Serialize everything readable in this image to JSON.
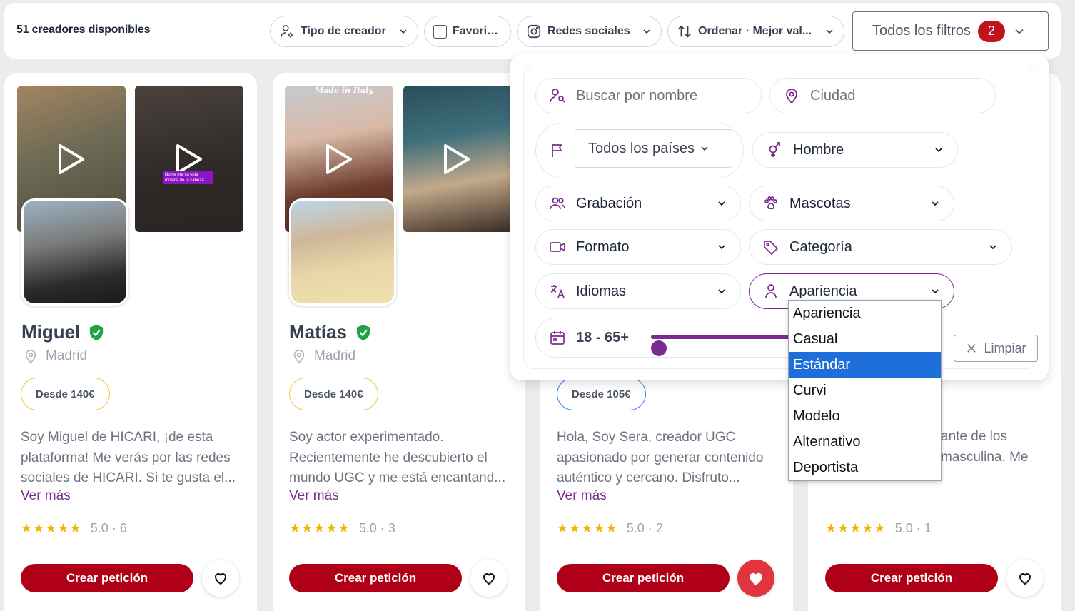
{
  "header": {
    "count_label": "51 creadores disponibles",
    "filters": [
      {
        "label": "Tipo de creador",
        "icon": "user-gear-icon"
      },
      {
        "label": "Favoritos",
        "icon": "checkbox-icon"
      },
      {
        "label": "Redes sociales",
        "icon": "instagram-icon"
      },
      {
        "label": "Ordenar · Mejor val...",
        "icon": "sort-icon"
      }
    ],
    "all_filters": {
      "label": "Todos los filtros",
      "badge": "2"
    }
  },
  "cards": [
    {
      "name": "Miguel",
      "verified": true,
      "city": "Madrid",
      "price": "Desde 140€",
      "description": "Soy Miguel de HICARI, ¡de esta plataforma! Me verás por las redes sociales de HICARI. Si te gusta el...",
      "more": "Ver más",
      "stars": "★★★★★",
      "rating": "5.0 · 6",
      "cta": "Crear petición",
      "favorite": false
    },
    {
      "name": "Matías",
      "verified": true,
      "city": "Madrid",
      "price": "Desde 140€",
      "description": "Soy actor experimentado. Recientemente he descubierto el mundo UGC y me está encantand...",
      "more": "Ver más",
      "stars": "★★★★★",
      "rating": "5.0 · 3",
      "cta": "Crear petición",
      "favorite": false
    },
    {
      "name": "",
      "verified": false,
      "city": "",
      "price": "Desde 105€",
      "description": "Hola, Soy Sera, creador UGC apasionado por generar contenido auténtico y cercano. Disfruto...",
      "more": "Ver más",
      "stars": "★★★★★",
      "rating": "5.0 · 2",
      "cta": "Crear petición",
      "favorite": true
    },
    {
      "name": "",
      "verified": false,
      "city": "",
      "price": "",
      "description_line1": "ante de los",
      "description_line2": "masculina. Me",
      "stars": "★★★★★",
      "rating": "5.0 · 1",
      "cta": "Crear petición",
      "favorite": false
    }
  ],
  "thumb_captions": {
    "made_in_italy": "Made in Italy",
    "subtitle": "No se me va esta música de la cabeza"
  },
  "panel": {
    "search_placeholder": "Buscar por nombre",
    "city_placeholder": "Ciudad",
    "country": "Todos los países",
    "gender": "Hombre",
    "recording": "Grabación",
    "pets": "Mascotas",
    "format": "Formato",
    "category": "Categoría",
    "languages": "Idiomas",
    "appearance": "Apariencia",
    "age_range": "18 - 65+",
    "clear": "Limpiar"
  },
  "appearance_options": [
    "Apariencia",
    "Casual",
    "Estándar",
    "Curvi",
    "Modelo",
    "Alternativo",
    "Deportista"
  ],
  "appearance_selected": "Estándar",
  "colors": {
    "accent": "#7b2c8f",
    "cta": "#b00018",
    "badge": "#c1121f",
    "selected_option": "#1e6fd9",
    "star": "#f5b301",
    "verified": "#22a34a"
  }
}
